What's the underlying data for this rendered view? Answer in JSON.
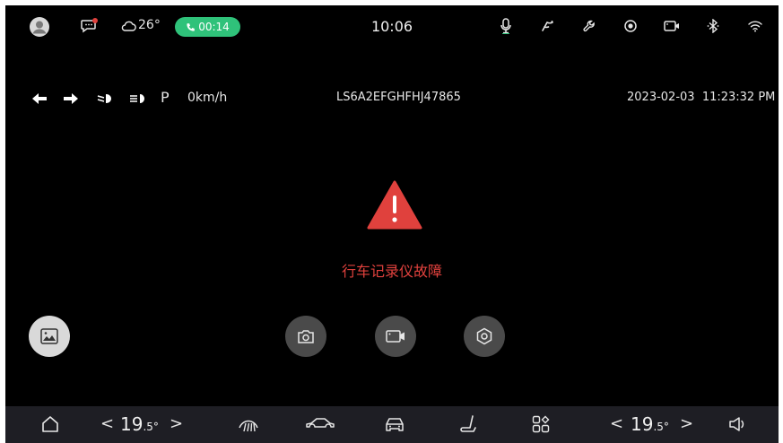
{
  "status_bar": {
    "weather_temp": "26°",
    "call_duration": "00:14",
    "time": "10:06",
    "icons": [
      "avatar-icon",
      "message-icon",
      "cloud-icon",
      "phone-icon",
      "microphone-icon",
      "wiper-icon",
      "wrench-icon",
      "record-icon",
      "camera-icon",
      "bluetooth-icon",
      "wifi-icon"
    ]
  },
  "info_bar": {
    "gear": "P",
    "speed": "0km/h",
    "vin": "LS6A2EFGHFHJ47865",
    "datetime": "2023-02-03  11:23:32 PM"
  },
  "alert": {
    "message": "行车记录仪故障",
    "color": "#e0413d"
  },
  "controls": {
    "buttons": [
      "gallery-button",
      "snapshot-button",
      "record-button",
      "settings-button"
    ]
  },
  "dock": {
    "left_temp_value": "19",
    "left_temp_decimal": ".5°",
    "right_temp_value": "19",
    "right_temp_decimal": ".5°",
    "prev_symbol": "<",
    "next_symbol": ">",
    "icons": [
      "home-icon",
      "defrost-icon",
      "car-side-icon",
      "car-front-icon",
      "seat-icon",
      "apps-icon",
      "volume-icon"
    ]
  },
  "colors": {
    "background": "#000000",
    "accent_green": "#2fc27a",
    "warning_red": "#e0413d",
    "dock_bg": "#1e1e24"
  }
}
